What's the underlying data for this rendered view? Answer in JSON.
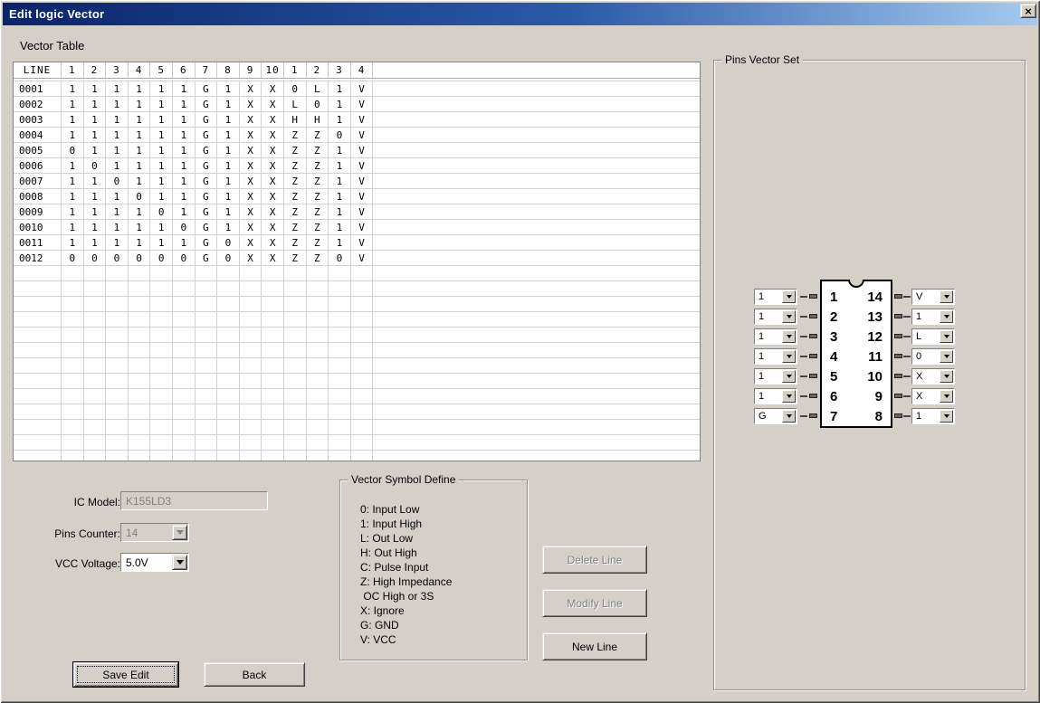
{
  "window": {
    "title": "Edit logic Vector",
    "close_glyph": "×"
  },
  "table": {
    "label": "Vector Table",
    "headers": [
      "LINE",
      "1",
      "2",
      "3",
      "4",
      "5",
      "6",
      "7",
      "8",
      "9",
      "10",
      "1",
      "2",
      "3",
      "4"
    ],
    "rows": [
      {
        "line": "0001",
        "values": [
          "1",
          "1",
          "1",
          "1",
          "1",
          "1",
          "G",
          "1",
          "X",
          "X",
          "0",
          "L",
          "1",
          "V"
        ]
      },
      {
        "line": "0002",
        "values": [
          "1",
          "1",
          "1",
          "1",
          "1",
          "1",
          "G",
          "1",
          "X",
          "X",
          "L",
          "0",
          "1",
          "V"
        ]
      },
      {
        "line": "0003",
        "values": [
          "1",
          "1",
          "1",
          "1",
          "1",
          "1",
          "G",
          "1",
          "X",
          "X",
          "H",
          "H",
          "1",
          "V"
        ]
      },
      {
        "line": "0004",
        "values": [
          "1",
          "1",
          "1",
          "1",
          "1",
          "1",
          "G",
          "1",
          "X",
          "X",
          "Z",
          "Z",
          "0",
          "V"
        ]
      },
      {
        "line": "0005",
        "values": [
          "0",
          "1",
          "1",
          "1",
          "1",
          "1",
          "G",
          "1",
          "X",
          "X",
          "Z",
          "Z",
          "1",
          "V"
        ]
      },
      {
        "line": "0006",
        "values": [
          "1",
          "0",
          "1",
          "1",
          "1",
          "1",
          "G",
          "1",
          "X",
          "X",
          "Z",
          "Z",
          "1",
          "V"
        ]
      },
      {
        "line": "0007",
        "values": [
          "1",
          "1",
          "0",
          "1",
          "1",
          "1",
          "G",
          "1",
          "X",
          "X",
          "Z",
          "Z",
          "1",
          "V"
        ]
      },
      {
        "line": "0008",
        "values": [
          "1",
          "1",
          "1",
          "0",
          "1",
          "1",
          "G",
          "1",
          "X",
          "X",
          "Z",
          "Z",
          "1",
          "V"
        ]
      },
      {
        "line": "0009",
        "values": [
          "1",
          "1",
          "1",
          "1",
          "0",
          "1",
          "G",
          "1",
          "X",
          "X",
          "Z",
          "Z",
          "1",
          "V"
        ]
      },
      {
        "line": "0010",
        "values": [
          "1",
          "1",
          "1",
          "1",
          "1",
          "0",
          "G",
          "1",
          "X",
          "X",
          "Z",
          "Z",
          "1",
          "V"
        ]
      },
      {
        "line": "0011",
        "values": [
          "1",
          "1",
          "1",
          "1",
          "1",
          "1",
          "G",
          "0",
          "X",
          "X",
          "Z",
          "Z",
          "1",
          "V"
        ]
      },
      {
        "line": "0012",
        "values": [
          "0",
          "0",
          "0",
          "0",
          "0",
          "0",
          "G",
          "0",
          "X",
          "X",
          "Z",
          "Z",
          "0",
          "V"
        ]
      }
    ],
    "empty_rows": 13
  },
  "form": {
    "ic_model_label": "IC Model:",
    "ic_model_value": "K155LD3",
    "pins_counter_label": "Pins Counter:",
    "pins_counter_value": "14",
    "vcc_label": "VCC Voltage:",
    "vcc_value": "5.0V"
  },
  "symbols": {
    "title": "Vector Symbol Define",
    "lines": [
      "0: Input Low",
      "1: Input High",
      "L: Out Low",
      "H: Out High",
      "C: Pulse Input",
      "Z: High Impedance",
      " OC High or 3S",
      "X: Ignore",
      "G: GND",
      "V: VCC"
    ]
  },
  "buttons": {
    "delete": "Delete Line",
    "modify": "Modify Line",
    "new": "New Line",
    "save": "Save Edit",
    "back": "Back"
  },
  "pins": {
    "title": "Pins Vector Set",
    "left": [
      {
        "pin": "1",
        "value": "1"
      },
      {
        "pin": "2",
        "value": "1"
      },
      {
        "pin": "3",
        "value": "1"
      },
      {
        "pin": "4",
        "value": "1"
      },
      {
        "pin": "5",
        "value": "1"
      },
      {
        "pin": "6",
        "value": "1"
      },
      {
        "pin": "7",
        "value": "G"
      }
    ],
    "right": [
      {
        "pin": "14",
        "value": "V"
      },
      {
        "pin": "13",
        "value": "1"
      },
      {
        "pin": "12",
        "value": "L"
      },
      {
        "pin": "11",
        "value": "0"
      },
      {
        "pin": "10",
        "value": "X"
      },
      {
        "pin": "9",
        "value": "X"
      },
      {
        "pin": "8",
        "value": "1"
      }
    ]
  }
}
